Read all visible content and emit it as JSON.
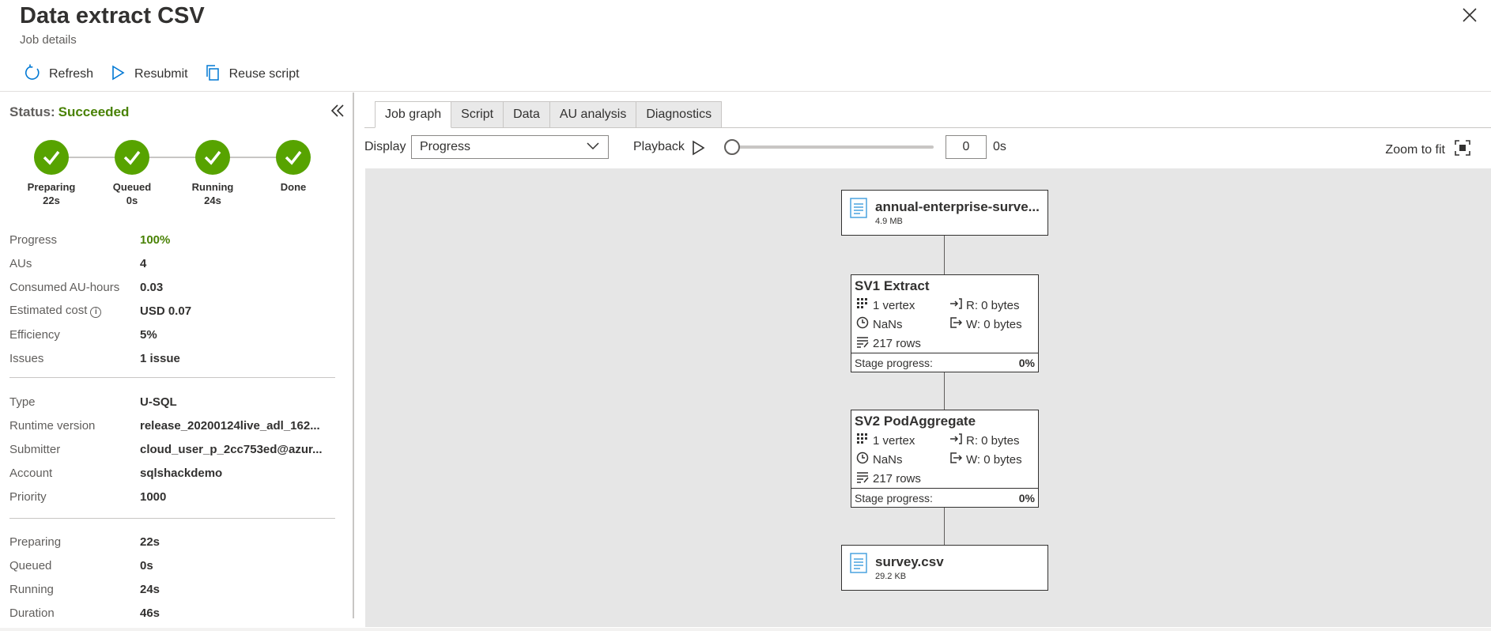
{
  "header": {
    "title": "Data extract CSV",
    "subtitle": "Job details",
    "toolbar": {
      "refresh_label": "Refresh",
      "resubmit_label": "Resubmit",
      "reuse_label": "Reuse script"
    }
  },
  "left": {
    "status_label": "Status:",
    "status_value": "Succeeded",
    "steps": [
      {
        "name": "Preparing",
        "time": "22s"
      },
      {
        "name": "Queued",
        "time": "0s"
      },
      {
        "name": "Running",
        "time": "24s"
      },
      {
        "name": "Done",
        "time": ""
      }
    ],
    "metrics": [
      {
        "key": "Progress",
        "value": "100%"
      },
      {
        "key": "AUs",
        "value": "4"
      },
      {
        "key": "Consumed AU-hours",
        "value": "0.03"
      },
      {
        "key": "Estimated cost",
        "value": "USD 0.07"
      },
      {
        "key": "Efficiency",
        "value": "5%"
      },
      {
        "key": "Issues",
        "value": "1 issue"
      }
    ],
    "details": [
      {
        "key": "Type",
        "value": "U-SQL"
      },
      {
        "key": "Runtime version",
        "value": "release_20200124live_adl_162..."
      },
      {
        "key": "Submitter",
        "value": "cloud_user_p_2cc753ed@azur..."
      },
      {
        "key": "Account",
        "value": "sqlshackdemo"
      },
      {
        "key": "Priority",
        "value": "1000"
      }
    ],
    "timings": [
      {
        "key": "Preparing",
        "value": "22s"
      },
      {
        "key": "Queued",
        "value": "0s"
      },
      {
        "key": "Running",
        "value": "24s"
      },
      {
        "key": "Duration",
        "value": "46s"
      }
    ]
  },
  "tabs": [
    "Job graph",
    "Script",
    "Data",
    "AU analysis",
    "Diagnostics"
  ],
  "controls": {
    "display_label": "Display",
    "display_value": "Progress",
    "playback_label": "Playback",
    "playback_value": "0",
    "playback_unit": "0s",
    "zoom_label": "Zoom to fit"
  },
  "graph": {
    "input_file": {
      "name": "annual-enterprise-surve...",
      "size": "4.9 MB"
    },
    "stages": [
      {
        "name": "SV1 Extract",
        "vertex": "1 vertex",
        "time": "NaNs",
        "rows": "217 rows",
        "read": "R: 0 bytes",
        "write": "W: 0 bytes",
        "progress_label": "Stage progress:",
        "progress_value": "0%"
      },
      {
        "name": "SV2 PodAggregate",
        "vertex": "1 vertex",
        "time": "NaNs",
        "rows": "217 rows",
        "read": "R: 0 bytes",
        "write": "W: 0 bytes",
        "progress_label": "Stage progress:",
        "progress_value": "0%"
      }
    ],
    "output_file": {
      "name": "survey.csv",
      "size": "29.2 KB"
    }
  },
  "colors": {
    "success": "#57a300",
    "success_text": "#498205",
    "accent": "#0078d4",
    "canvas_bg": "#e6e6e6"
  }
}
